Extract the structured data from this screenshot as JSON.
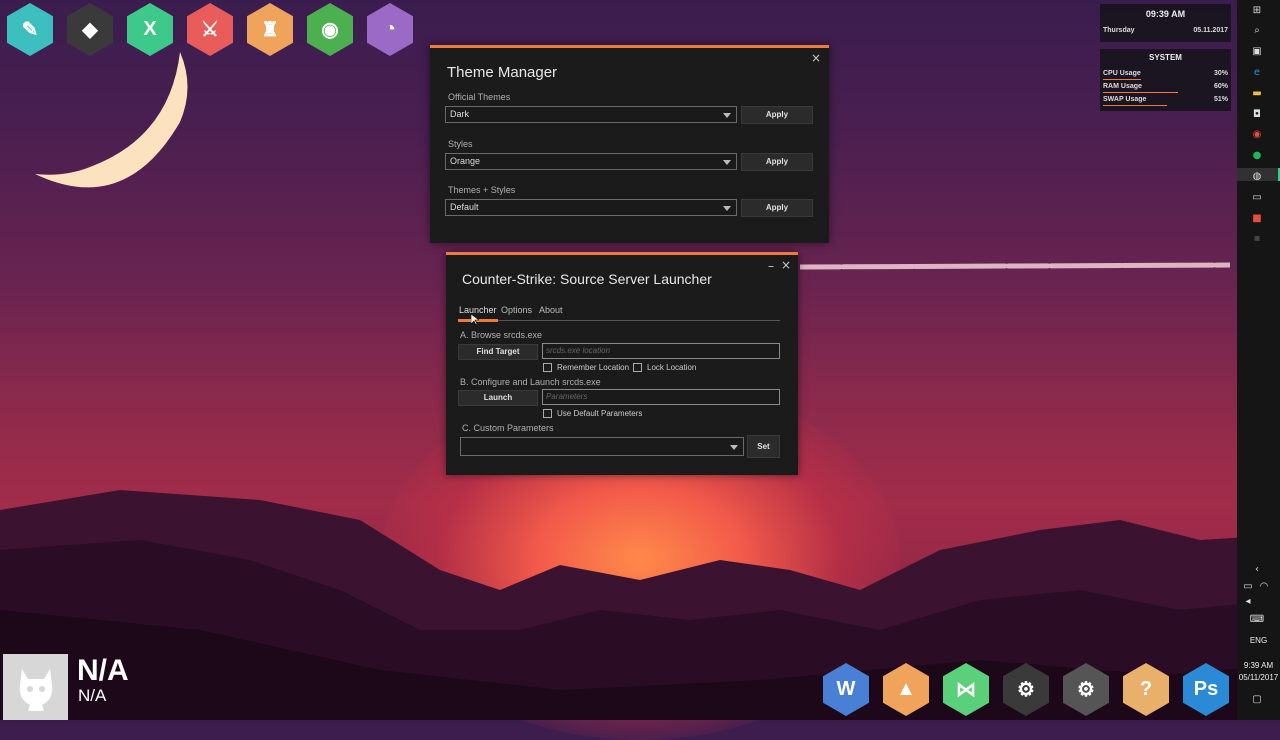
{
  "colors": {
    "accent": "#f07a3a",
    "window_bg": "#1b1b1b",
    "taskbar_bg": "#151515"
  },
  "launcher_icons": [
    {
      "name": "sticky-notes-icon",
      "glyph": "✎",
      "color": "#3ebfbf"
    },
    {
      "name": "fox-mask-icon",
      "glyph": "◆",
      "color": "#3a3a3a"
    },
    {
      "name": "xing-x-icon",
      "glyph": "X",
      "color": "#3cc98a"
    },
    {
      "name": "dota-icon",
      "glyph": "⚔",
      "color": "#e85c5c"
    },
    {
      "name": "counter-strike-icon",
      "glyph": "♜",
      "color": "#f0a35a"
    },
    {
      "name": "chrome-icon",
      "glyph": "◉",
      "color": "#4caf50"
    },
    {
      "name": "tor-browser-icon",
      "glyph": "◔",
      "color": "#9b6ac7"
    }
  ],
  "theme_manager": {
    "title": "Theme Manager",
    "close": "×",
    "official_label": "Official Themes",
    "official_value": "Dark",
    "styles_label": "Styles",
    "styles_value": "Orange",
    "themes_styles_label": "Themes + Styles",
    "themes_styles_value": "Default",
    "apply": "Apply"
  },
  "launcher": {
    "title": "Counter-Strike: Source Server Launcher",
    "minimize": "–",
    "close": "×",
    "tabs": [
      "Launcher",
      "Options",
      "About"
    ],
    "section_a": "A. Browse srcds.exe",
    "find_target": "Find Target",
    "location_placeholder": "srcds.exe location",
    "remember_location": "Remember Location",
    "lock_location": "Lock Location",
    "section_b": "B. Configure and Launch srcds.exe",
    "launch": "Launch",
    "parameters_placeholder": "Parameters",
    "use_default": "Use Default Parameters",
    "section_c": "C. Custom Parameters",
    "custom_value": "",
    "set": "Set"
  },
  "clock_widget": {
    "time": "09:39 AM",
    "day": "Thursday",
    "date": "05.11.2017"
  },
  "system_widget": {
    "title": "SYSTEM",
    "rows": [
      {
        "label": "CPU Usage",
        "value": "30%",
        "fraction": 0.3
      },
      {
        "label": "RAM Usage",
        "value": "60%",
        "fraction": 0.6
      },
      {
        "label": "SWAP Usage",
        "value": "51%",
        "fraction": 0.51
      }
    ]
  },
  "taskbar": {
    "top_icons": [
      "windows-start-icon",
      "search-icon",
      "task-view-icon",
      "edge-icon",
      "file-explorer-icon",
      "store-icon",
      "chrome-icon",
      "spotify-icon",
      "steam-icon",
      "cmd-icon",
      "app-red-icon",
      "terminal-icon"
    ],
    "language": "ENG",
    "time": "9:39 AM",
    "date": "05/11/2017"
  },
  "dock_icons": [
    {
      "name": "word-icon",
      "glyph": "W",
      "color": "#4a7fd6"
    },
    {
      "name": "vlc-icon",
      "glyph": "▲",
      "color": "#f0a35a"
    },
    {
      "name": "visual-studio-icon",
      "glyph": "⋈",
      "color": "#5bd07a"
    },
    {
      "name": "steam-icon",
      "glyph": "⚙",
      "color": "#3a3a3a"
    },
    {
      "name": "settings-icon",
      "glyph": "⚙",
      "color": "#555555"
    },
    {
      "name": "help-icon",
      "glyph": "?",
      "color": "#e8b06a"
    },
    {
      "name": "photoshop-icon",
      "glyph": "Ps",
      "color": "#2a8ad6"
    }
  ],
  "now_playing": {
    "title": "N/A",
    "artist": "N/A"
  }
}
